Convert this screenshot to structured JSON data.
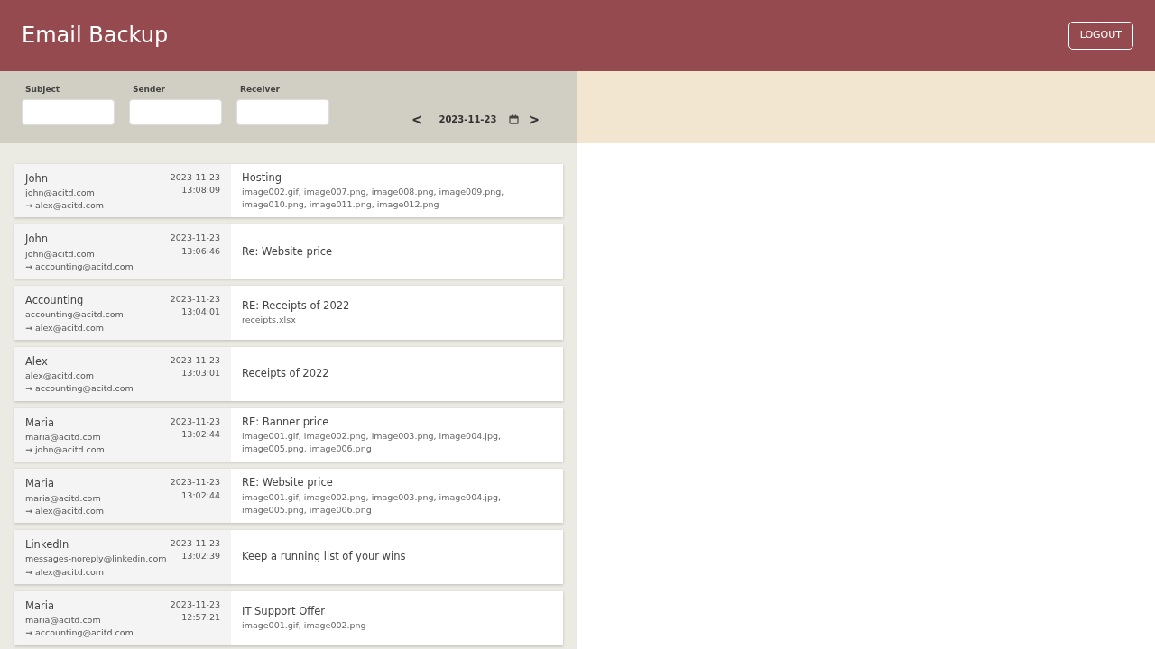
{
  "header": {
    "title": "Email Backup",
    "logout": "LOGOUT"
  },
  "filters": [
    {
      "label": "Subject"
    },
    {
      "label": "Sender"
    },
    {
      "label": "Receiver"
    }
  ],
  "date_nav": {
    "prev": "<",
    "date": "2023-11-23",
    "next": ">"
  },
  "emails": [
    {
      "name": "John",
      "from": "john@acitd.com",
      "to": "→ alex@acitd.com",
      "date": "2023-11-23",
      "time": "13:08:09",
      "subject": "Hosting",
      "attachments": "image002.gif, image007.png, image008.png, image009.png, image010.png, image011.png, image012.png"
    },
    {
      "name": "John",
      "from": "john@acitd.com",
      "to": "→ accounting@acitd.com",
      "date": "2023-11-23",
      "time": "13:06:46",
      "subject": "Re: Website price"
    },
    {
      "name": "Accounting",
      "from": "accounting@acitd.com",
      "to": "→ alex@acitd.com",
      "date": "2023-11-23",
      "time": "13:04:01",
      "subject": "RE: Receipts of 2022",
      "attachments": "receipts.xlsx"
    },
    {
      "name": "Alex",
      "from": "alex@acitd.com",
      "to": "→ accounting@acitd.com",
      "date": "2023-11-23",
      "time": "13:03:01",
      "subject": "Receipts of 2022"
    },
    {
      "name": "Maria",
      "from": "maria@acitd.com",
      "to": "→ john@acitd.com",
      "date": "2023-11-23",
      "time": "13:02:44",
      "subject": "RE: Banner price",
      "attachments": "image001.gif, image002.png, image003.png, image004.jpg, image005.png, image006.png"
    },
    {
      "name": "Maria",
      "from": "maria@acitd.com",
      "to": "→ alex@acitd.com",
      "date": "2023-11-23",
      "time": "13:02:44",
      "subject": "RE: Website price",
      "attachments": "image001.gif, image002.png, image003.png, image004.jpg, image005.png, image006.png"
    },
    {
      "name": "LinkedIn",
      "from": "messages-noreply@linkedin.com",
      "to": "→ alex@acitd.com",
      "date": "2023-11-23",
      "time": "13:02:39",
      "subject": "Keep a running list of your wins"
    },
    {
      "name": "Maria",
      "from": "maria@acitd.com",
      "to": "→ accounting@acitd.com",
      "date": "2023-11-23",
      "time": "12:57:21",
      "subject": "IT Support Offer",
      "attachments": "image001.gif, image002.png"
    }
  ]
}
